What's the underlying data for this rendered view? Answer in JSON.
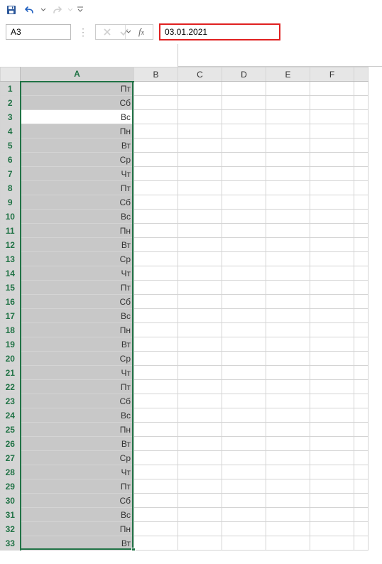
{
  "qat": {
    "save": "save-icon",
    "undo": "undo-icon",
    "redo": "redo-icon"
  },
  "name_box": {
    "value": "A3"
  },
  "formula_bar": {
    "value": "03.01.2021"
  },
  "columns": [
    "A",
    "B",
    "C",
    "D",
    "E",
    "F"
  ],
  "selected_column": "A",
  "active_cell_row": 3,
  "rows": [
    {
      "n": 1,
      "a": "Пт"
    },
    {
      "n": 2,
      "a": "Сб"
    },
    {
      "n": 3,
      "a": "Вс"
    },
    {
      "n": 4,
      "a": "Пн"
    },
    {
      "n": 5,
      "a": "Вт"
    },
    {
      "n": 6,
      "a": "Ср"
    },
    {
      "n": 7,
      "a": "Чт"
    },
    {
      "n": 8,
      "a": "Пт"
    },
    {
      "n": 9,
      "a": "Сб"
    },
    {
      "n": 10,
      "a": "Вс"
    },
    {
      "n": 11,
      "a": "Пн"
    },
    {
      "n": 12,
      "a": "Вт"
    },
    {
      "n": 13,
      "a": "Ср"
    },
    {
      "n": 14,
      "a": "Чт"
    },
    {
      "n": 15,
      "a": "Пт"
    },
    {
      "n": 16,
      "a": "Сб"
    },
    {
      "n": 17,
      "a": "Вс"
    },
    {
      "n": 18,
      "a": "Пн"
    },
    {
      "n": 19,
      "a": "Вт"
    },
    {
      "n": 20,
      "a": "Ср"
    },
    {
      "n": 21,
      "a": "Чт"
    },
    {
      "n": 22,
      "a": "Пт"
    },
    {
      "n": 23,
      "a": "Сб"
    },
    {
      "n": 24,
      "a": "Вс"
    },
    {
      "n": 25,
      "a": "Пн"
    },
    {
      "n": 26,
      "a": "Вт"
    },
    {
      "n": 27,
      "a": "Ср"
    },
    {
      "n": 28,
      "a": "Чт"
    },
    {
      "n": 29,
      "a": "Пт"
    },
    {
      "n": 30,
      "a": "Сб"
    },
    {
      "n": 31,
      "a": "Вс"
    },
    {
      "n": 32,
      "a": "Пн"
    },
    {
      "n": 33,
      "a": "Вт"
    }
  ]
}
